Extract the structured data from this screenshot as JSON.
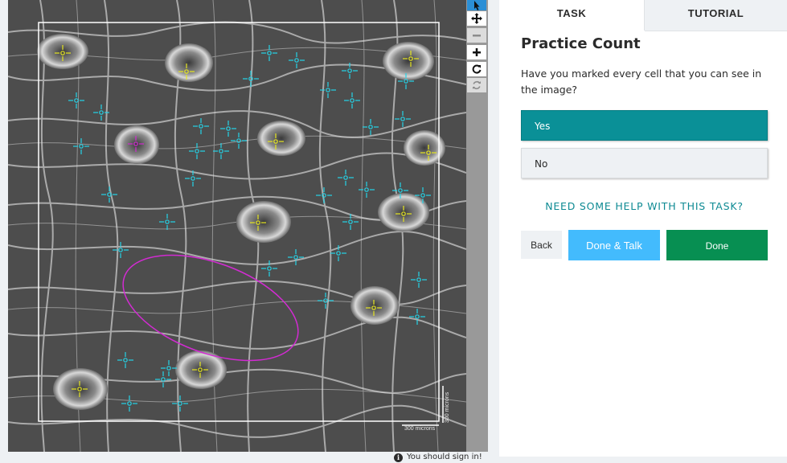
{
  "subject": {
    "scale_label": "300 microns",
    "scale_label_vertical": "300 microns"
  },
  "toolbar": {
    "tools": [
      "pointer-tool",
      "pan-tool",
      "zoom-out",
      "zoom-in",
      "rotate",
      "reset"
    ]
  },
  "tabs": {
    "task": "TASK",
    "tutorial": "TUTORIAL"
  },
  "task": {
    "title": "Practice Count",
    "question": "Have you marked every cell that you can see in the image?",
    "answers": [
      "Yes",
      "No"
    ],
    "selected_answer": "Yes"
  },
  "help_link": "NEED SOME HELP WITH THIS TASK?",
  "buttons": {
    "back": "Back",
    "done_talk": "Done & Talk",
    "done": "Done"
  },
  "signin_notice": "You should sign in!",
  "colors": {
    "cyan_marker": "#25d4e8",
    "yellow_marker": "#e6e621",
    "magenta_marker": "#d22bd2",
    "yes_selected": "#0a9097",
    "done": "#078f52",
    "done_talk": "#43bbfd"
  }
}
